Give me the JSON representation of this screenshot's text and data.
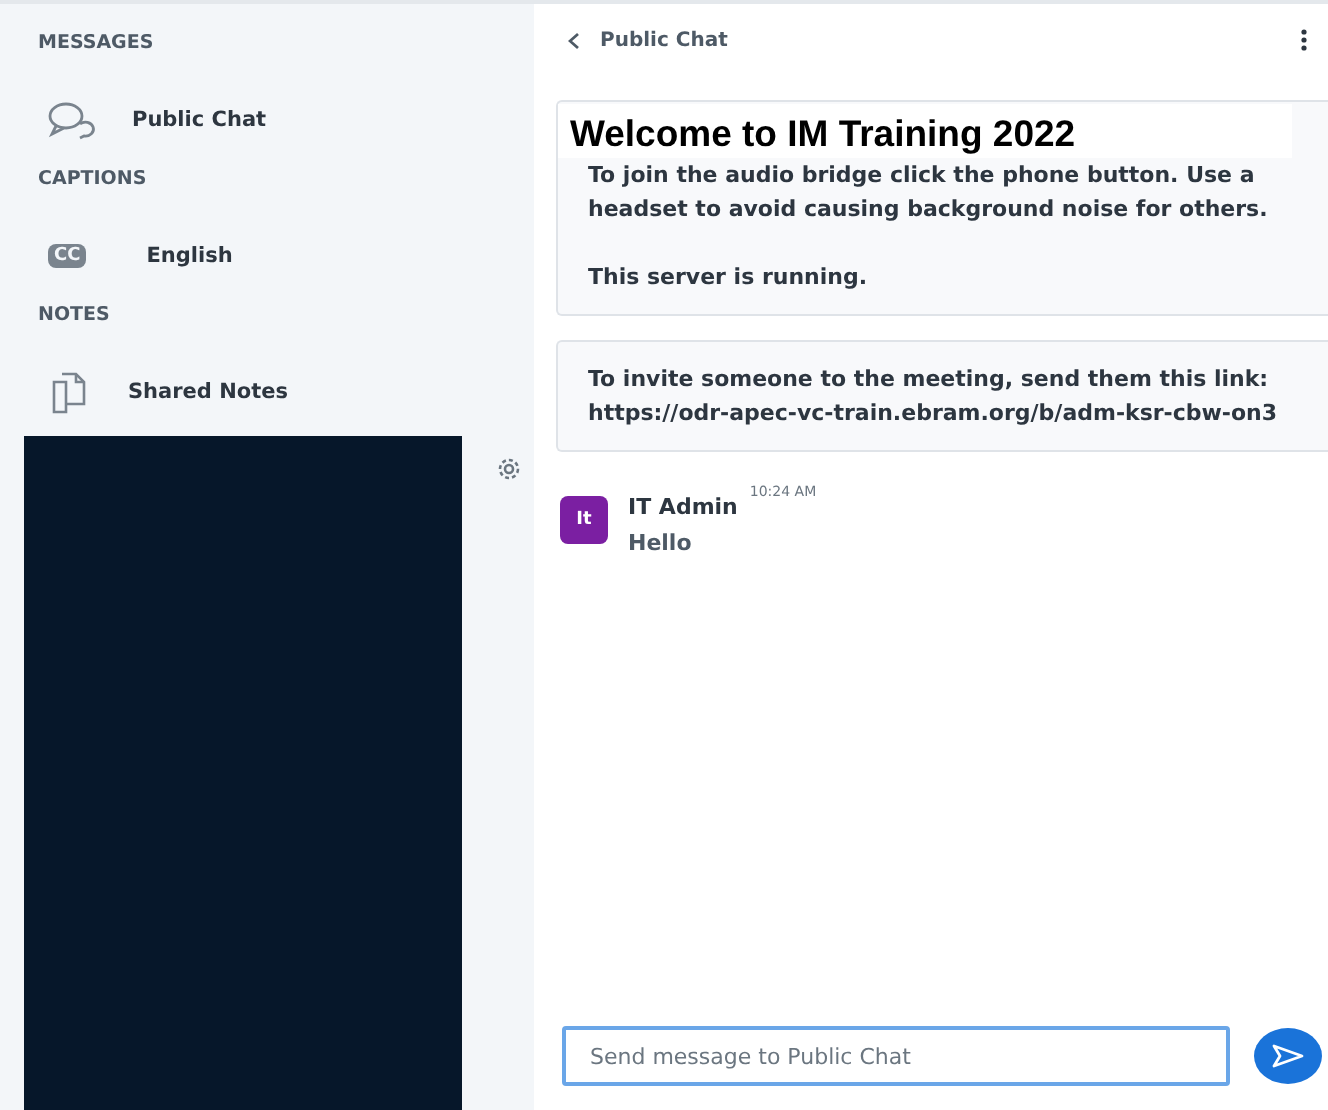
{
  "sidebar": {
    "sections": [
      {
        "heading": "MESSAGES",
        "items": [
          {
            "kind": "chat",
            "label": "Public Chat"
          }
        ]
      },
      {
        "heading": "CAPTIONS",
        "items": [
          {
            "kind": "captions",
            "label": "English",
            "icon_text": "CC"
          }
        ]
      },
      {
        "heading": "NOTES",
        "items": [
          {
            "kind": "notes",
            "label": "Shared Notes"
          }
        ]
      }
    ]
  },
  "chat": {
    "title": "Public Chat",
    "welcome": {
      "title": "Welcome to IM Training 2022",
      "paragraphs": [
        "To join the audio bridge click the phone button. Use a headset to avoid causing background noise for others.",
        "This server is running."
      ]
    },
    "invite": {
      "text": "To invite someone to the meeting, send them this link: https://odr-apec-vc-train.ebram.org/b/adm-ksr-cbw-on3"
    },
    "messages": [
      {
        "avatar": "It",
        "color": "#7b1fa2",
        "author": "IT Admin",
        "time": "10:24 AM",
        "text": "Hello"
      }
    ],
    "input": {
      "placeholder": "Send message to Public Chat"
    }
  }
}
